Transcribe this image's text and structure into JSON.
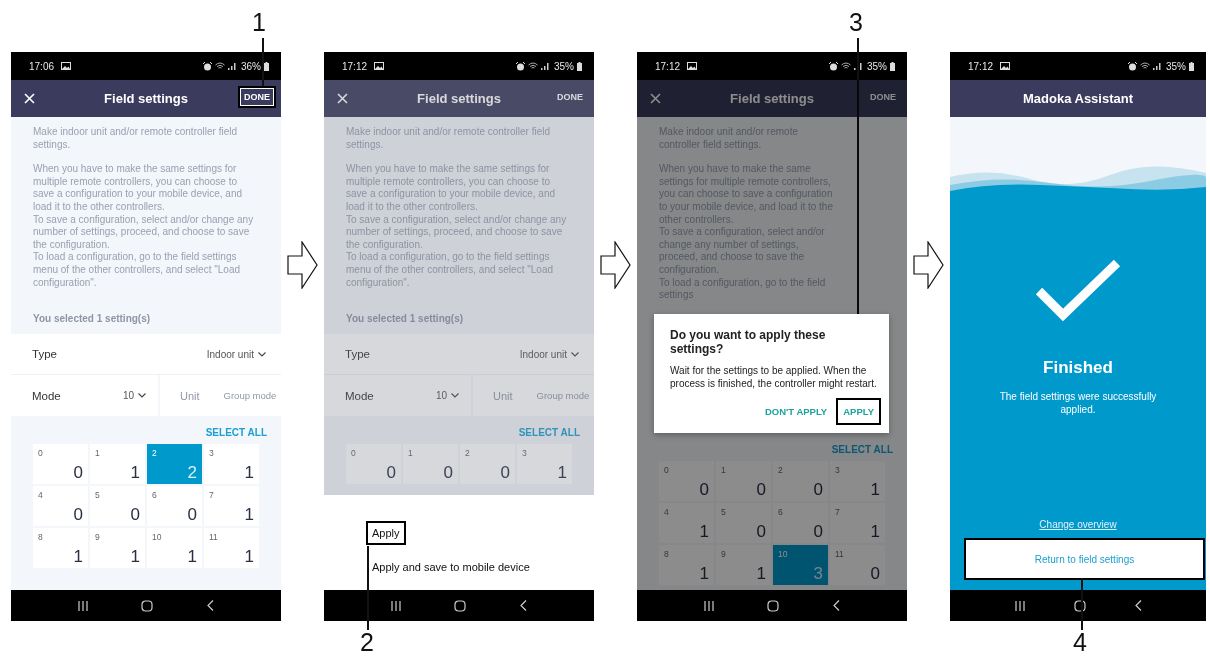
{
  "screens": [
    {
      "kind": "settings",
      "status": {
        "time": "17:06",
        "battery": "36%"
      },
      "header": {
        "title": "Field settings",
        "action": {
          "label": "DONE",
          "highlighted": true
        }
      },
      "intro": [
        "Make indoor unit and/or remote controller field settings.",
        "When you have to make the same settings for multiple remote controllers, you can choose to save a configuration to your mobile device, and load it to the other controllers.\nTo save a configuration, select and/or change any number of settings, proceed, and choose to save the configuration.\nTo load a configuration, go to the field settings menu of the other controllers, and select \"Load configuration\"."
      ],
      "selected_count": "You selected 1 setting(s)",
      "type_row": {
        "label": "Type",
        "value": "Indoor unit"
      },
      "mode_row": {
        "label": "Mode",
        "value": "10",
        "options": [
          {
            "label": "Unit",
            "disabled": true
          },
          {
            "label": "Group mode",
            "disabled": true
          }
        ]
      },
      "select_all": "SELECT ALL",
      "grid": [
        {
          "index": "0",
          "value": "0",
          "selected": false
        },
        {
          "index": "1",
          "value": "1",
          "selected": false
        },
        {
          "index": "2",
          "value": "2",
          "selected": true
        },
        {
          "index": "3",
          "value": "1",
          "selected": false
        },
        {
          "index": "4",
          "value": "0",
          "selected": false
        },
        {
          "index": "5",
          "value": "0",
          "selected": false
        },
        {
          "index": "6",
          "value": "0",
          "selected": false
        },
        {
          "index": "7",
          "value": "1",
          "selected": false
        },
        {
          "index": "8",
          "value": "1",
          "selected": false
        },
        {
          "index": "9",
          "value": "1",
          "selected": false
        },
        {
          "index": "10",
          "value": "1",
          "selected": false
        },
        {
          "index": "11",
          "value": "1",
          "selected": false
        }
      ]
    },
    {
      "kind": "settings",
      "dimmed": true,
      "status": {
        "time": "17:12",
        "battery": "35%"
      },
      "header": {
        "title": "Field settings",
        "action": {
          "label": "DONE",
          "highlighted": false
        }
      },
      "intro": [
        "Make indoor unit and/or remote controller field settings.",
        "When you have to make the same settings for multiple remote controllers, you can choose to save a configuration to your mobile device, and load it to the other controllers.\nTo save a configuration, select and/or change any number of settings, proceed, and choose to save the configuration.\nTo load a configuration, go to the field settings menu of the other controllers, and select \"Load configuration\"."
      ],
      "selected_count": "You selected 1 setting(s)",
      "type_row": {
        "label": "Type",
        "value": "Indoor unit"
      },
      "mode_row": {
        "label": "Mode",
        "value": "10",
        "options": [
          {
            "label": "Unit",
            "disabled": true
          },
          {
            "label": "Group mode",
            "disabled": true
          }
        ]
      },
      "select_all": "SELECT ALL",
      "grid": [
        {
          "index": "0",
          "value": "0",
          "selected": false
        },
        {
          "index": "1",
          "value": "0",
          "selected": false
        },
        {
          "index": "2",
          "value": "0",
          "selected": false
        },
        {
          "index": "3",
          "value": "1",
          "selected": false
        }
      ],
      "sheet": [
        {
          "label": "Apply",
          "highlighted": true
        },
        {
          "label": "Apply and save to mobile device",
          "highlighted": false
        }
      ]
    },
    {
      "kind": "settings",
      "dimmed": true,
      "status": {
        "time": "17:12",
        "battery": "35%"
      },
      "header": {
        "title": "Field settings",
        "action": {
          "label": "DONE",
          "highlighted": false
        }
      },
      "intro": [
        "Make indoor unit and/or remote controller field settings.",
        "When you have to make the same settings for multiple remote controllers, you can choose to save a configuration to your mobile device, and load it to the other controllers.\nTo save a configuration, select and/or change any number of settings, proceed, and choose to save the configuration.\nTo load a configuration, go to the field settings"
      ],
      "dialog": {
        "title": "Do you want to apply these settings?",
        "message": "Wait for the settings to be applied. When the process is finished, the controller might restart.",
        "buttons": [
          {
            "label": "DON'T APPLY",
            "highlighted": false
          },
          {
            "label": "APPLY",
            "highlighted": true
          }
        ]
      },
      "select_all": "SELECT ALL",
      "grid": [
        {
          "index": "0",
          "value": "0",
          "selected": false
        },
        {
          "index": "1",
          "value": "0",
          "selected": false
        },
        {
          "index": "2",
          "value": "0",
          "selected": false
        },
        {
          "index": "3",
          "value": "1",
          "selected": false
        },
        {
          "index": "4",
          "value": "1",
          "selected": false
        },
        {
          "index": "5",
          "value": "0",
          "selected": false
        },
        {
          "index": "6",
          "value": "0",
          "selected": false
        },
        {
          "index": "7",
          "value": "1",
          "selected": false
        },
        {
          "index": "8",
          "value": "1",
          "selected": false
        },
        {
          "index": "9",
          "value": "1",
          "selected": false
        },
        {
          "index": "10",
          "value": "3",
          "selected": true
        },
        {
          "index": "11",
          "value": "0",
          "selected": false
        }
      ]
    },
    {
      "kind": "result",
      "status": {
        "time": "17:12",
        "battery": "35%"
      },
      "header": {
        "title": "Madoka Assistant"
      },
      "result": {
        "title": "Finished",
        "message": "The field settings were successfully applied.",
        "link": "Change overview",
        "button": {
          "label": "Return to field settings",
          "highlighted": true
        }
      }
    }
  ],
  "callouts": [
    {
      "number": "1"
    },
    {
      "number": "2"
    },
    {
      "number": "3"
    },
    {
      "number": "4"
    }
  ]
}
